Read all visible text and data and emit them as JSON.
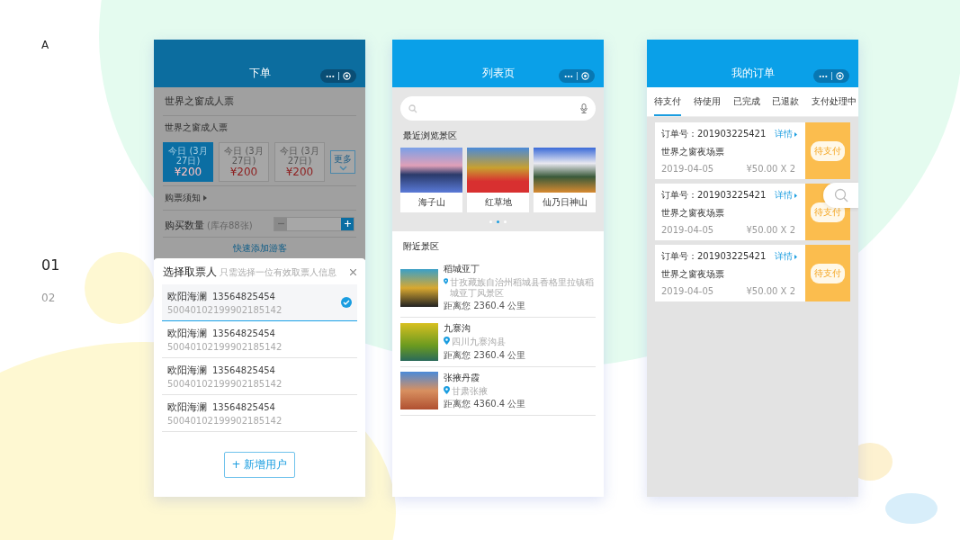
{
  "slide": {
    "section_letter": "A",
    "page_numbers": [
      {
        "label": "01",
        "selected": true
      },
      {
        "label": "02",
        "selected": false
      }
    ]
  },
  "order_screen": {
    "title": "下单",
    "ticket_name": "世界之窗成人票",
    "ticket_type": "世界之窗成人票",
    "date_options": [
      {
        "date": "今日 (3月27日)",
        "price": "¥200",
        "selected": true
      },
      {
        "date": "今日 (3月27日)",
        "price": "¥200",
        "selected": false
      },
      {
        "date": "今日 (3月27日)",
        "price": "¥200",
        "selected": false
      }
    ],
    "more_label": "更多",
    "notice_label": "购票须知",
    "quantity_label": "购买数量",
    "stock": "(库存88张)",
    "decrease_disabled": true,
    "quick_add_label": "快速添加游客",
    "picker": {
      "title": "选择取票人",
      "hint": "只需选择一位有效取票人信息",
      "people": [
        {
          "name": "欧阳海澜",
          "phone": "13564825454",
          "id_number": "50040102199902185142",
          "selected": true
        },
        {
          "name": "欧阳海澜",
          "phone": "13564825454",
          "id_number": "50040102199902185142",
          "selected": false
        },
        {
          "name": "欧阳海澜",
          "phone": "13564825454",
          "id_number": "50040102199902185142",
          "selected": false
        },
        {
          "name": "欧阳海澜",
          "phone": "13564825454",
          "id_number": "50040102199902185142",
          "selected": false
        }
      ],
      "add_button": "+ 新增用户"
    }
  },
  "list_screen": {
    "title": "列表页",
    "recent_title": "最近浏览景区",
    "recent": [
      {
        "name": "海子山"
      },
      {
        "name": "红草地"
      },
      {
        "name": "仙乃日神山"
      }
    ],
    "pager": [
      {
        "selected": false
      },
      {
        "selected": true
      },
      {
        "selected": false
      }
    ],
    "nearby_title": "附近景区",
    "nearby": [
      {
        "name": "稻城亚丁",
        "address": "甘孜藏族自治州稻城县香格里拉镇稻城亚丁风景区",
        "distance": "距离您 2360.4 公里"
      },
      {
        "name": "九寨沟",
        "address": "四川九寨沟县",
        "distance": "距离您 2360.4 公里"
      },
      {
        "name": "张掖丹霞",
        "address": "甘肃张掖",
        "distance": "距离您 4360.4 公里"
      }
    ]
  },
  "orders_screen": {
    "title": "我的订单",
    "tabs": [
      {
        "label": "待支付",
        "selected": true
      },
      {
        "label": "待使用",
        "selected": false
      },
      {
        "label": "已完成",
        "selected": false
      },
      {
        "label": "已退款",
        "selected": false
      },
      {
        "label": "支付处理中",
        "selected": false
      }
    ],
    "orders": [
      {
        "order_no": "订单号：201903225421",
        "detail": "详情",
        "ticket": "世界之窗夜场票",
        "date": "2019-04-05",
        "price": "¥50.00 X 2",
        "status": "待支付"
      },
      {
        "order_no": "订单号：201903225421",
        "detail": "详情",
        "ticket": "世界之窗夜场票",
        "date": "2019-04-05",
        "price": "¥50.00 X 2",
        "status": "待支付"
      },
      {
        "order_no": "订单号：201903225421",
        "detail": "详情",
        "ticket": "世界之窗夜场票",
        "date": "2019-04-05",
        "price": "¥50.00 X 2",
        "status": "待支付"
      }
    ]
  }
}
